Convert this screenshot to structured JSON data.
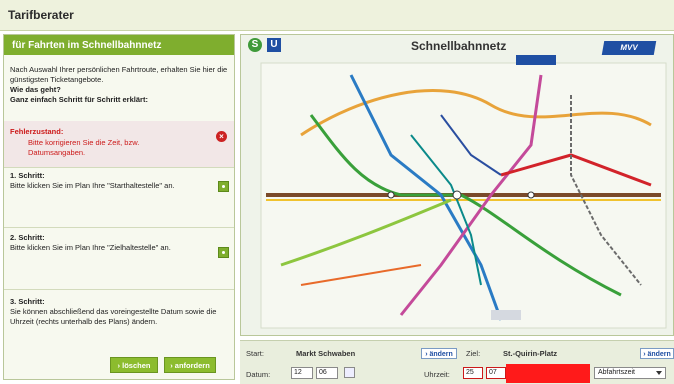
{
  "header": {
    "title": "Tarifberater"
  },
  "left_panel": {
    "heading": "für Fahrten im Schnellbahnnetz",
    "intro_text": "Nach Auswahl Ihrer persönlichen Fahrtroute, erhalten Sie hier die günstigsten Ticketangebote.",
    "intro_bold_1": "Wie das geht?",
    "intro_bold_2": "Ganz einfach Schritt für Schritt erklärt:",
    "error_title": "Fehlerzustand:",
    "error_message": "Bitte korrigieren Sie die Zeit, bzw. Datumsangaben.",
    "step1_title": "1. Schritt:",
    "step1_text": "Bitte klicken Sie im Plan Ihre \"Starthaltestelle\" an.",
    "step2_title": "2. Schritt:",
    "step2_text": "Bitte klicken Sie im Plan Ihre \"Zielhaltestelle\" an.",
    "step3_title": "3. Schritt:",
    "step3_text": "Sie können abschließend das voreingestellte Datum sowie die Uhrzeit (rechts unterhalb des Plans) ändern.",
    "delete_button": "› löschen",
    "request_button": "› anfordern"
  },
  "map": {
    "title": "Schnellbahnnetz",
    "badge_s": "S",
    "badge_u": "U",
    "logo": "MVV"
  },
  "form": {
    "start_label": "Start:",
    "start_value": "Markt Schwaben",
    "change_start": "› ändern",
    "ziel_label": "Ziel:",
    "ziel_value": "St.-Quirin-Platz",
    "change_ziel": "› ändern",
    "date_label": "Datum:",
    "date_day": "12",
    "date_month": "06",
    "time_label": "Uhrzeit:",
    "time_hour": "25",
    "time_minute": "07",
    "time_mode": "Abfahrtszeit"
  },
  "colors": {
    "accent_green": "#7fae2e",
    "error_red": "#cc1a1a",
    "brand_blue": "#1f4fa3"
  }
}
